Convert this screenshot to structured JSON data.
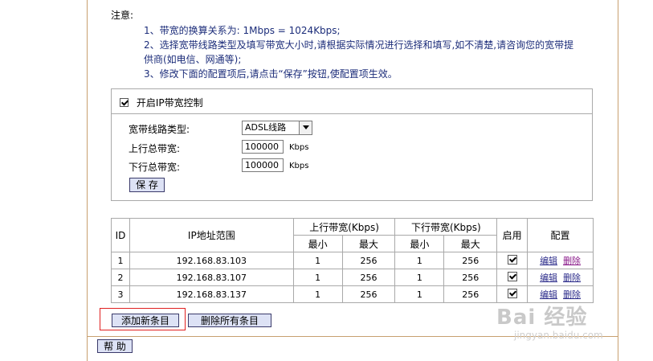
{
  "notes": {
    "title": "注意:",
    "line1": "1、带宽的换算关系为: 1Mbps = 1024Kbps;",
    "line2": "2、选择宽带线路类型及填写带宽大小时,请根据实际情况进行选择和填写,如不清楚,请咨询您的宽带提",
    "line3": "供商(如电信、网通等);",
    "line4": "3、修改下面的配置项后,请点击“保存”按钮,使配置项生效。"
  },
  "control": {
    "enable_label": "开启IP带宽控制",
    "enabled": true,
    "line_type_label": "宽带线路类型:",
    "line_type_value": "ADSL线路",
    "up_label": "上行总带宽:",
    "up_value": "100000",
    "down_label": "下行总带宽:",
    "down_value": "100000",
    "unit": "Kbps",
    "save_label": "保 存"
  },
  "table": {
    "headers": {
      "id": "ID",
      "ip_range": "IP地址范围",
      "up": "上行带宽(Kbps)",
      "down": "下行带宽(Kbps)",
      "min": "最小",
      "max": "最大",
      "enable": "启用",
      "config": "配置"
    },
    "rows": [
      {
        "id": "1",
        "ip": "192.168.83.103",
        "up_min": "1",
        "up_max": "256",
        "down_min": "1",
        "down_max": "256",
        "edit": "编辑",
        "delete": "删除"
      },
      {
        "id": "2",
        "ip": "192.168.83.107",
        "up_min": "1",
        "up_max": "256",
        "down_min": "1",
        "down_max": "256",
        "edit": "编辑",
        "delete": "删除"
      },
      {
        "id": "3",
        "ip": "192.168.83.137",
        "up_min": "1",
        "up_max": "256",
        "down_min": "1",
        "down_max": "256",
        "edit": "编辑",
        "delete": "删除"
      }
    ]
  },
  "actions": {
    "add_label": "添加新条目",
    "delete_all_label": "删除所有条目",
    "help_label": "帮 助"
  },
  "watermark": {
    "brand": "Bai 经验",
    "sub": "jingyan.baidu.com"
  }
}
